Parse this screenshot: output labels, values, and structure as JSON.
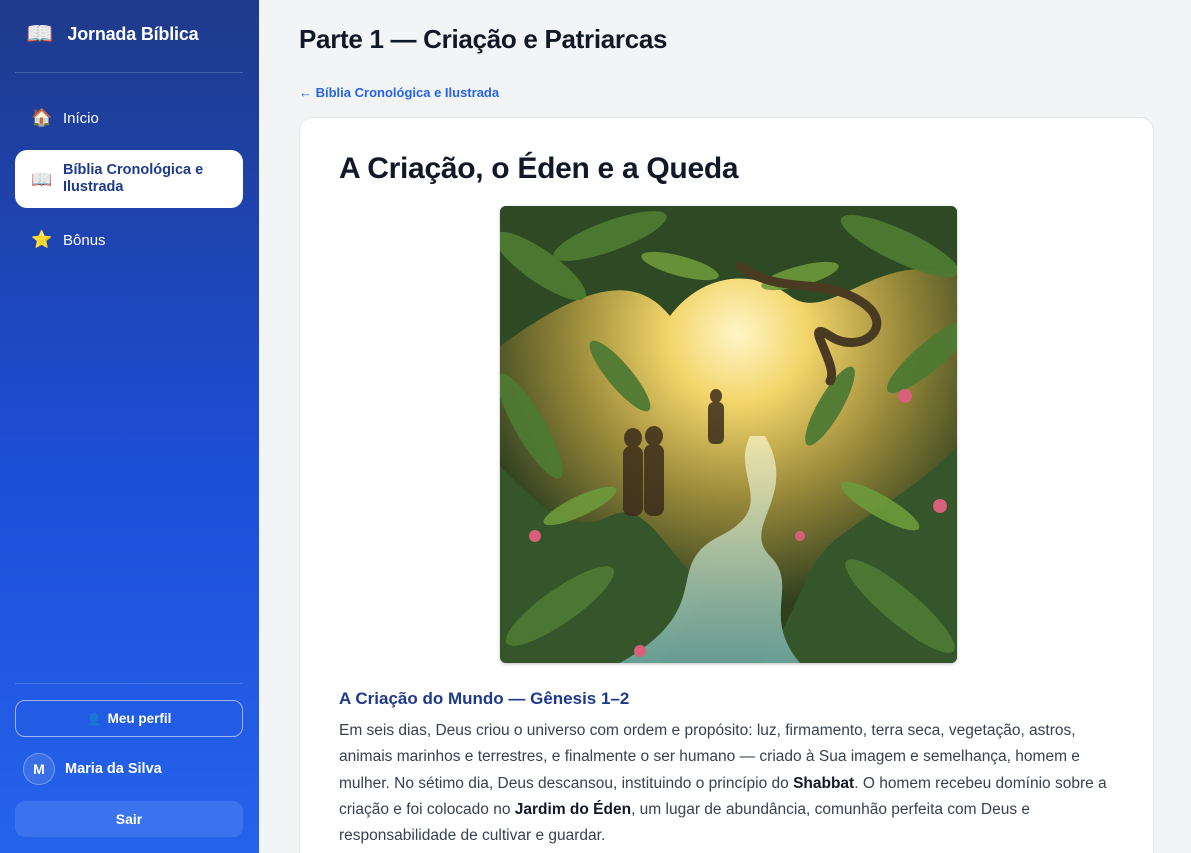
{
  "app": {
    "title": "Jornada Bíblica",
    "icon": "open-book-icon"
  },
  "sidebar": {
    "items": [
      {
        "label": "Início",
        "icon": "house-icon",
        "active": false
      },
      {
        "label": "Bíblia Cronológica e Ilustrada",
        "icon": "open-book-icon",
        "active": true
      },
      {
        "label": "Bônus",
        "icon": "star-icon",
        "active": false
      }
    ],
    "profile_label": "Meu perfil",
    "user": {
      "initial": "M",
      "name": "Maria da Silva"
    },
    "logout_label": "Sair"
  },
  "header": {
    "title": "Parte 1 — Criação e Patriarcas",
    "back_link": "← Bíblia Cronológica e Ilustrada"
  },
  "lesson": {
    "title": "A Criação, o Éden e a Queda",
    "section_title": "A Criação do Mundo — Gênesis 1–2",
    "text_1": "Em seis dias, Deus criou o universo com ordem e propósito: luz, firmamento, terra seca, vegetação, astros, animais marinhos e terrestres, e finalmente o ser humano — criado à Sua imagem e semelhança, homem e mulher. No sétimo dia, Deus descansou, instituindo o princípio do ",
    "bold_1": "Shabbat",
    "text_2": ". O homem recebeu domínio sobre a criação e foi colocado no ",
    "bold_2": "Jardim do Éden",
    "text_3": ", um lugar de abundância, comunhão perfeita com Deus e responsabilidade de cultivar e guardar."
  },
  "colors": {
    "sidebar_top": "#1e3a8a",
    "sidebar_bottom": "#2563eb",
    "accent": "#2563eb",
    "section_title": "#1e3a8a"
  }
}
